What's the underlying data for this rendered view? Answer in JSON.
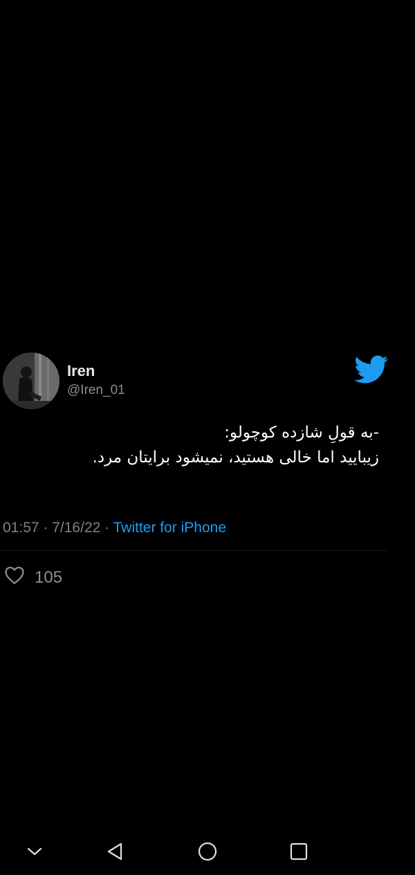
{
  "tweet": {
    "display_name": "Iren",
    "handle": "@Iren_01",
    "text_lines": [
      "-به قولِ شازده کوچولو:",
      "زیبایید اما خالی هستید، نمیشود برایتان مرد."
    ],
    "time": "01:57",
    "date": "7/16/22",
    "source": "Twitter for iPhone",
    "likes": "105"
  },
  "icons": {
    "brand": "twitter-bird-icon",
    "like": "heart-outline-icon",
    "nav": [
      "chevron-down-icon",
      "back-triangle-icon",
      "home-circle-icon",
      "recents-square-icon"
    ]
  },
  "colors": {
    "background": "#000000",
    "accent": "#1d9bf0",
    "text": "#ffffff",
    "muted": "#7d8287"
  }
}
